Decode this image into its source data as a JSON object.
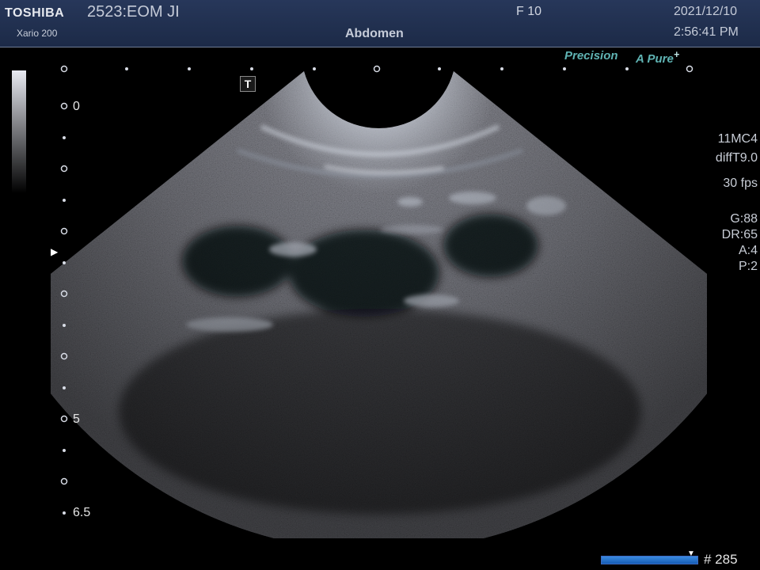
{
  "header": {
    "brand": "TOSHIBA",
    "model": "Xario 200",
    "patient": "2523:EOM JI",
    "frame_label": "F  10",
    "preset": "Abdomen",
    "date": "2021/12/10",
    "time": "2:56:41 PM"
  },
  "branding": {
    "precision": "Precision",
    "apure_a": "A",
    "apure_word": "Pure",
    "apure_mark": "+"
  },
  "depth_scale": {
    "labels": [
      "0",
      "5",
      "6.5"
    ]
  },
  "marker": "T",
  "parameters": {
    "probe": "11MC4",
    "mode": "diffT9.0",
    "fps": "30 fps",
    "gain": "G:88",
    "dynamic_range": "DR:65",
    "a": "A:4",
    "p": "P:2"
  },
  "cine": {
    "frame_count": "# 285",
    "position": 1.0
  },
  "colors": {
    "header_bg": "#1f2e4e",
    "brand_teal": "#5fb3b3",
    "cine_bar": "#1f6fd0"
  }
}
